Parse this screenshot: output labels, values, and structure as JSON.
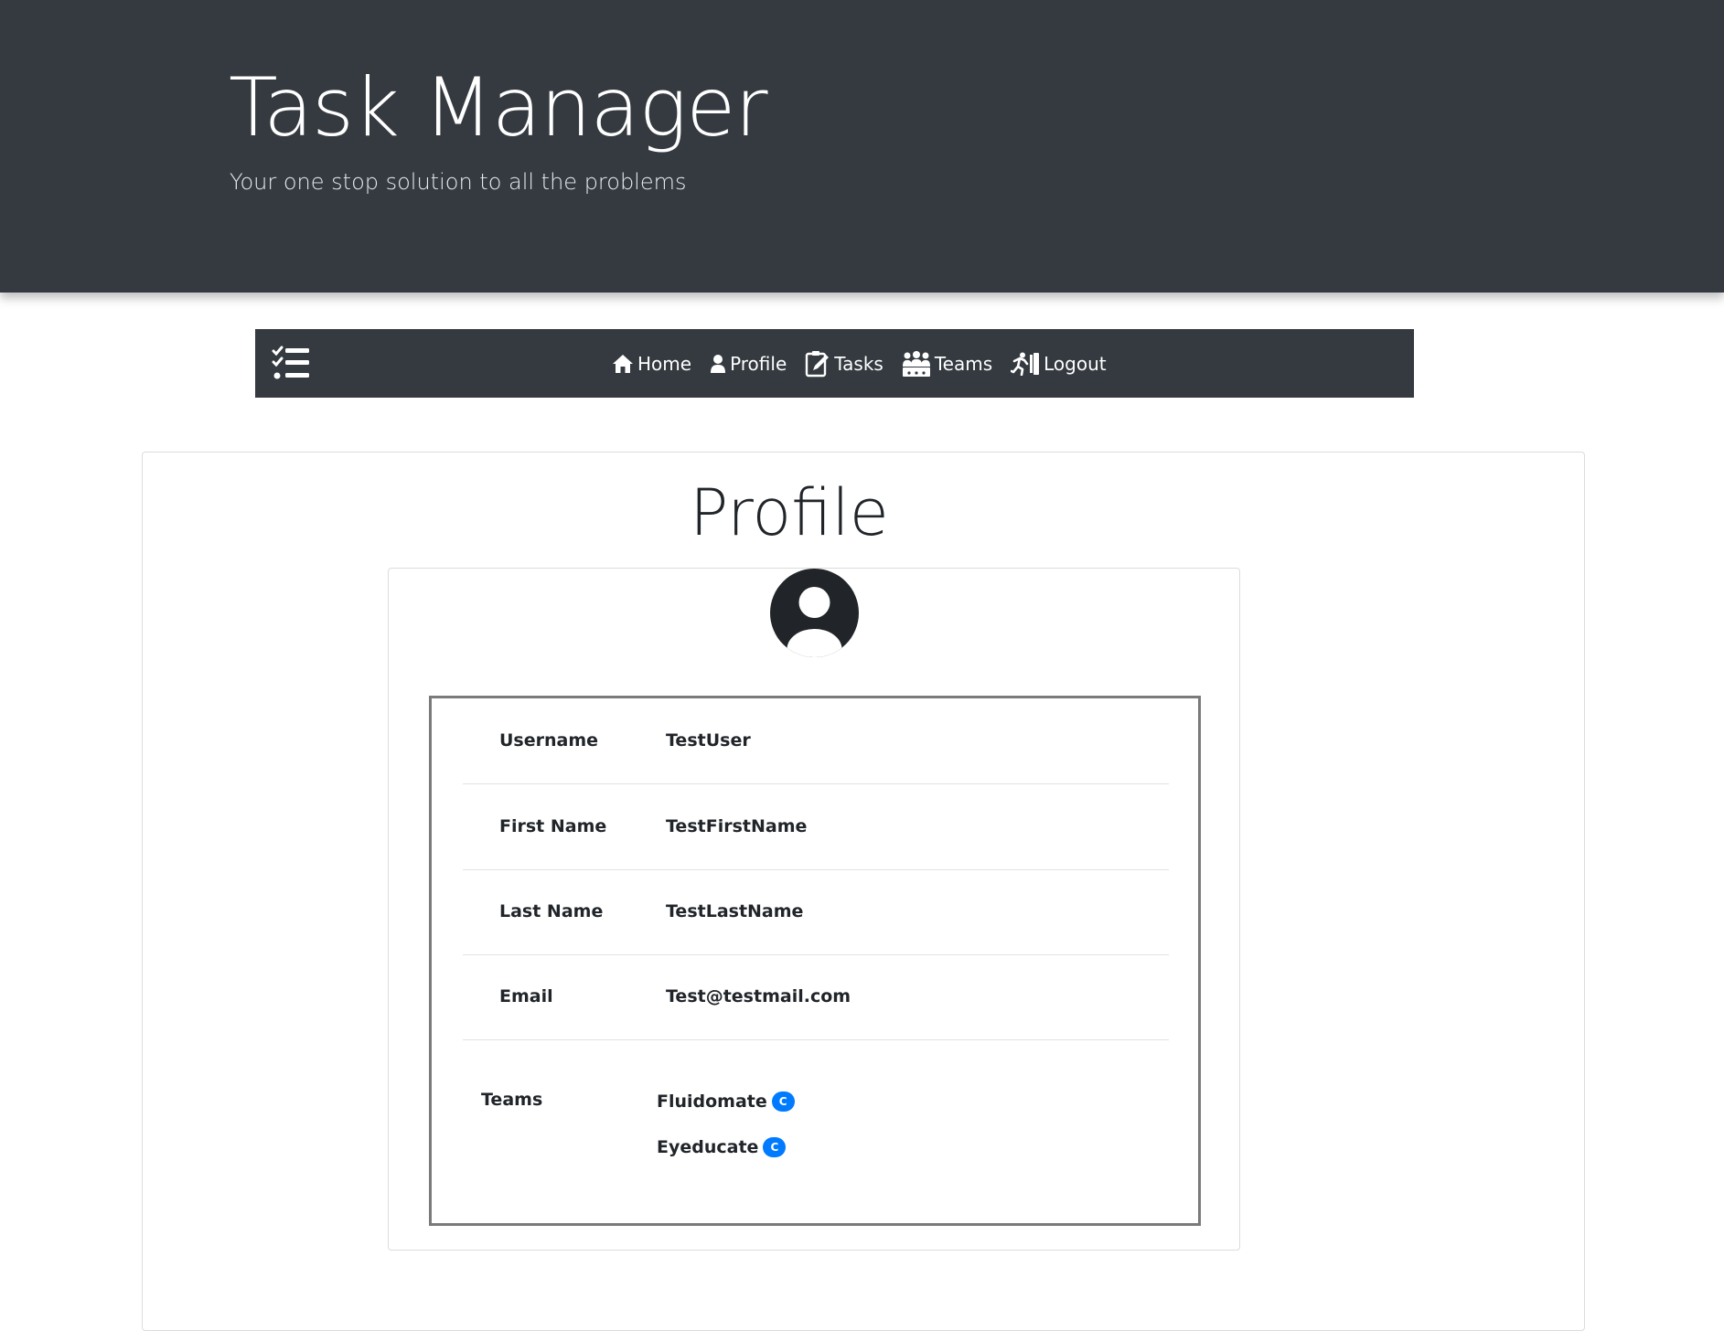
{
  "header": {
    "title": "Task Manager",
    "subtitle": "Your one stop solution to all the problems"
  },
  "navbar": {
    "brand_icon": "tasks-list-icon",
    "links": [
      {
        "label": "Home",
        "icon": "home-icon"
      },
      {
        "label": "Profile",
        "icon": "user-icon"
      },
      {
        "label": "Tasks",
        "icon": "clipboard-edit-icon"
      },
      {
        "label": "Teams",
        "icon": "people-group-icon"
      },
      {
        "label": "Logout",
        "icon": "running-exit-icon"
      }
    ]
  },
  "page": {
    "title": "Profile"
  },
  "profile": {
    "avatar_icon": "user-circle-icon",
    "fields": [
      {
        "label": "Username",
        "value": "TestUser"
      },
      {
        "label": "First Name",
        "value": "TestFirstName"
      },
      {
        "label": "Last Name",
        "value": "TestLastName"
      },
      {
        "label": "Email",
        "value": "Test@testmail.com"
      }
    ],
    "teams_label": "Teams",
    "teams": [
      {
        "name": "Fluidomate",
        "badge": "C"
      },
      {
        "name": "Eyeducate",
        "badge": "C"
      }
    ]
  },
  "colors": {
    "header_bg": "#343a40",
    "navbar_bg": "#343a40",
    "badge_bg": "#007bff",
    "details_border": "#7a7a7a"
  }
}
